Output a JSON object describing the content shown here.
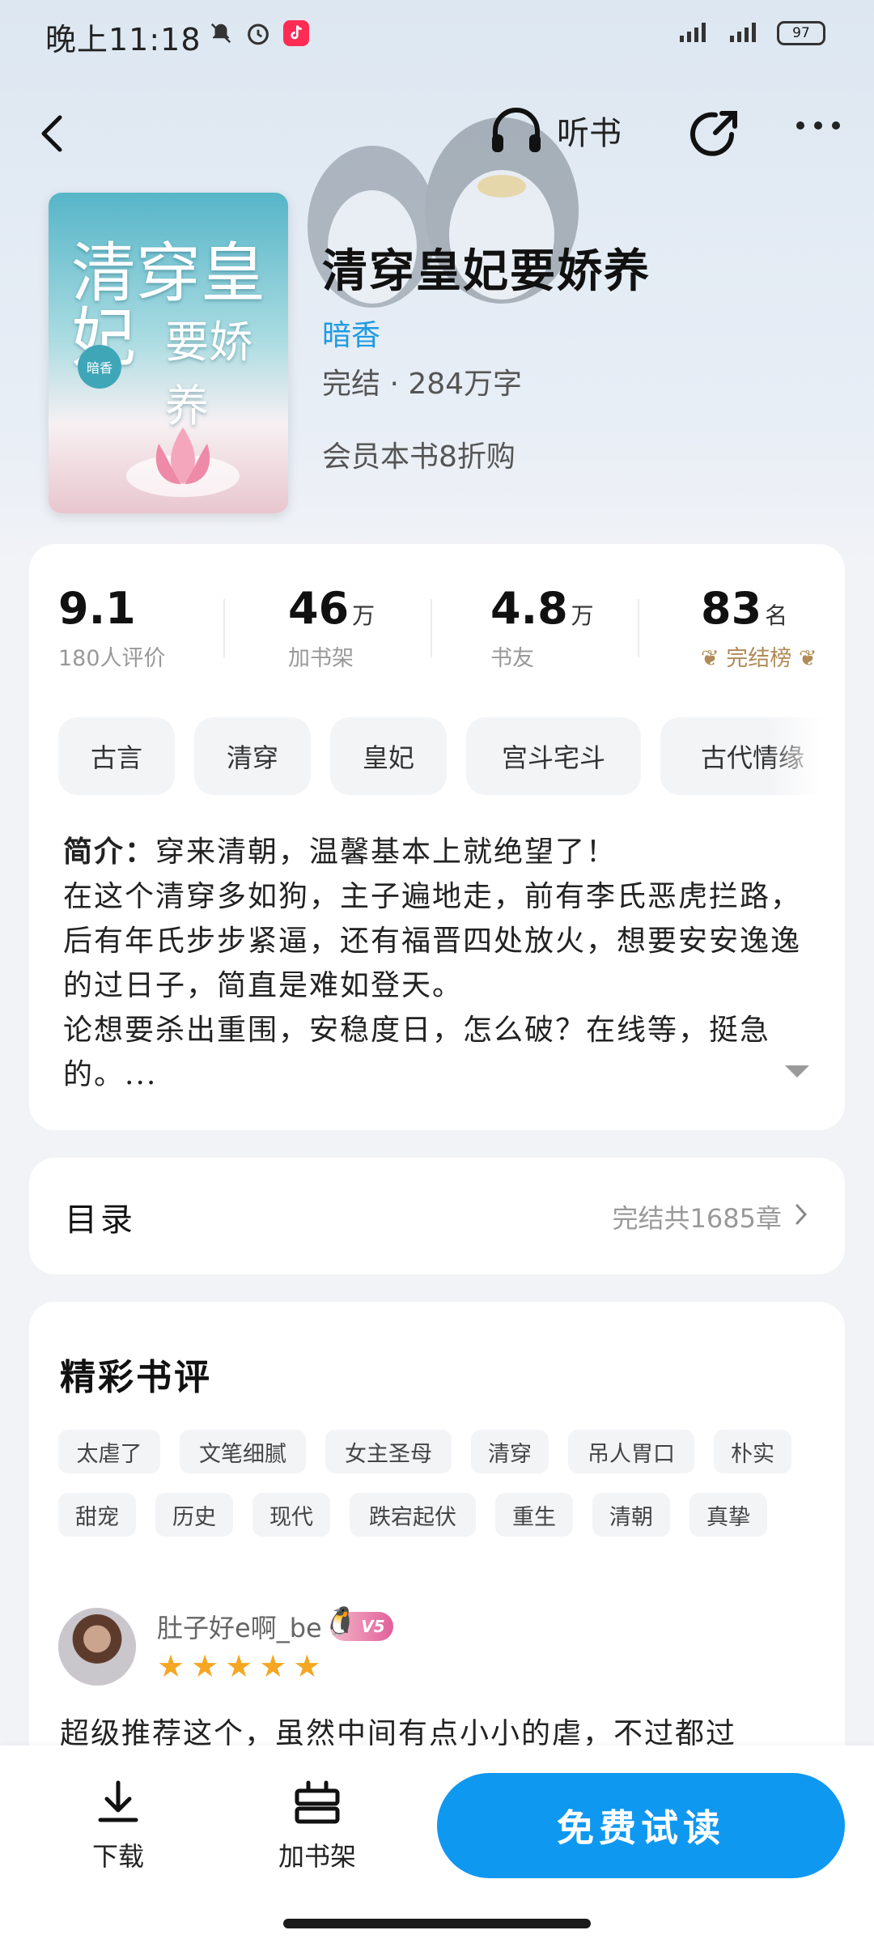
{
  "status_bar": {
    "time": "晚上11:18",
    "battery": "97"
  },
  "nav": {
    "listen_label": "听书"
  },
  "book": {
    "title": "清穿皇妃要娇养",
    "author": "暗香",
    "status": "完结 · 284万字",
    "vip_offer": "会员本书8折购",
    "cover_title_line1": "清穿皇妃",
    "cover_title_line2": "要娇养",
    "cover_author_mark": "暗香"
  },
  "stats": [
    {
      "value": "9.1",
      "unit": "",
      "label": "180人评价"
    },
    {
      "value": "46",
      "unit": "万",
      "label": "加书架"
    },
    {
      "value": "4.8",
      "unit": "万",
      "label": "书友"
    },
    {
      "value": "83",
      "unit": "名",
      "label": "完结榜"
    }
  ],
  "tags": [
    "古言",
    "清穿",
    "皇妃",
    "宫斗宅斗",
    "古代情缘"
  ],
  "intro": {
    "label": "简介：",
    "line1": "穿来清朝，温馨基本上就绝望了！",
    "para2": "在这个清穿多如狗，主子遍地走，前有李氏恶虎拦路，后有年氏步步紧逼，还有福晋四处放火，想要安安逸逸的过日子，简直是难如登天。",
    "para3": "论想要杀出重围，安稳度日，怎么破？在线等，挺急的。..."
  },
  "toc": {
    "title": "目录",
    "count": "完结共1685章"
  },
  "reviews": {
    "title": "精彩书评",
    "tags_row1": [
      "太虐了",
      "文笔细腻",
      "女主圣母",
      "清穿",
      "吊人胃口",
      "朴实"
    ],
    "tags_row2": [
      "甜宠",
      "历史",
      "现代",
      "跌宕起伏",
      "重生",
      "清朝",
      "真挚"
    ],
    "first": {
      "user": "肚子好e啊_be",
      "level": "V5",
      "stars": 5,
      "text": "超级推荐这个，虽然中间有点小小的虐，不过都过"
    }
  },
  "bottom": {
    "download": "下载",
    "add_shelf": "加书架",
    "read_free": "免费试读"
  }
}
